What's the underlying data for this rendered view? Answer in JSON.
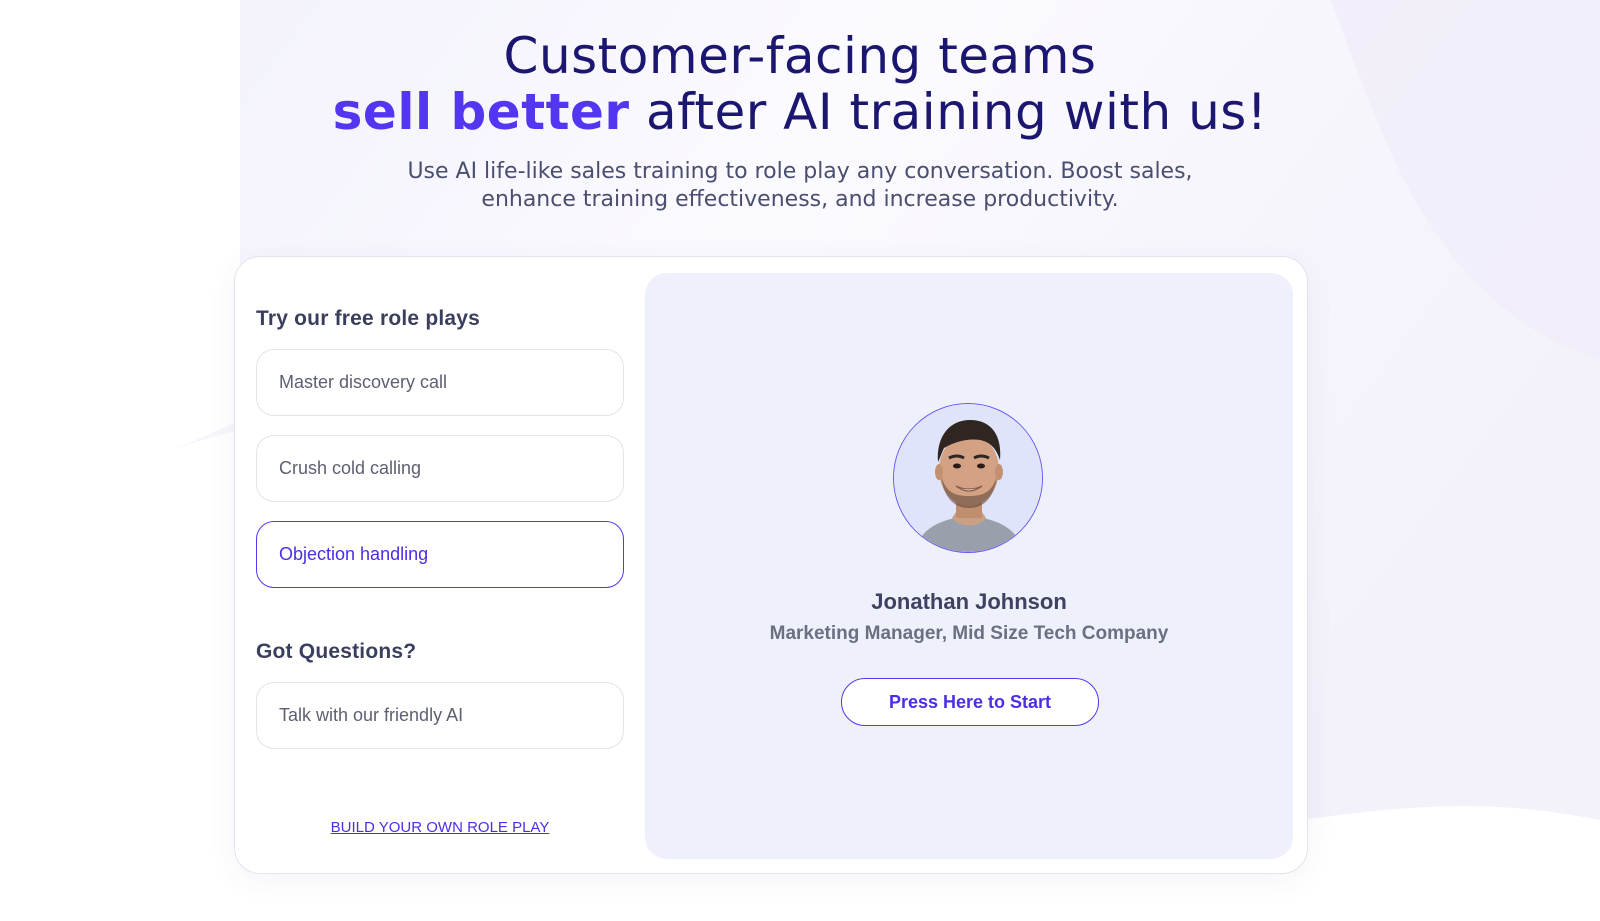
{
  "hero": {
    "headline_line1": "Customer-facing teams",
    "headline_accent": "sell better",
    "headline_rest": " after AI training with us!",
    "subline_line1": "Use AI life-like sales training to role play any conversation. Boost sales,",
    "subline_line2": "enhance training effectiveness, and increase productivity."
  },
  "roleplays": {
    "title": "Try our free role plays",
    "options": [
      {
        "label": "Master discovery call",
        "active": false
      },
      {
        "label": "Crush cold calling",
        "active": false
      },
      {
        "label": "Objection handling",
        "active": true
      }
    ]
  },
  "questions": {
    "title": "Got Questions?",
    "option_label": "Talk with our friendly AI"
  },
  "build_link": "BUILD YOUR OWN ROLE PLAY",
  "persona": {
    "name": "Jonathan Johnson",
    "role": "Marketing Manager, Mid Size Tech Company",
    "start_label": "Press Here to Start",
    "avatar_icon": "person-portrait-icon"
  },
  "colors": {
    "accent": "#5236f2",
    "headline": "#1b1670",
    "panel": "#eef0fc"
  }
}
